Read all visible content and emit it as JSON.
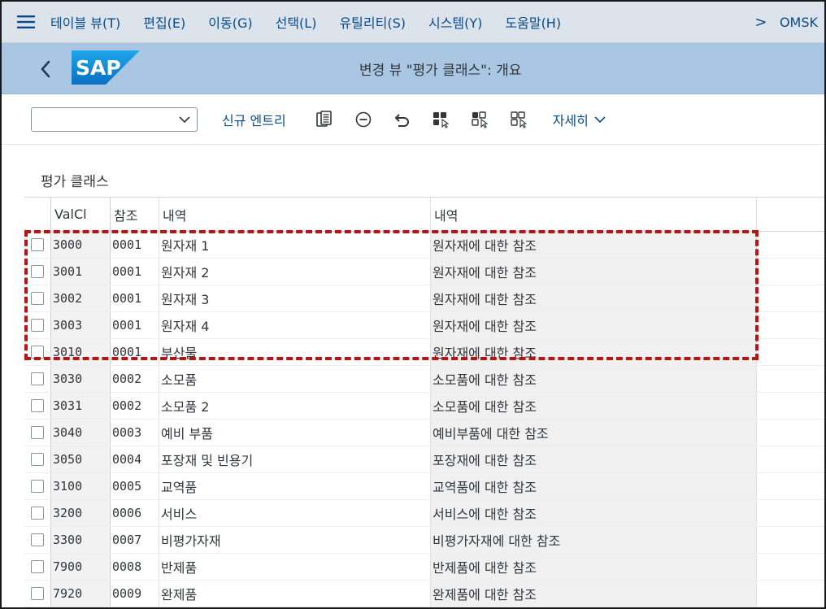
{
  "menu": {
    "items": [
      "테이블 뷰(T)",
      "편집(E)",
      "이동(G)",
      "선택(L)",
      "유틸리티(S)",
      "시스템(Y)",
      "도움말(H)"
    ],
    "more_glyph": ">",
    "system_id": "OMSK"
  },
  "titlebar": {
    "logo_text": "SAP",
    "title": "변경 뷰 \"평가 클래스\": 개요"
  },
  "toolbar": {
    "new_entries_label": "신규 엔트리",
    "details_label": "자세히"
  },
  "section": {
    "title": "평가 클래스"
  },
  "table": {
    "headers": {
      "valcl": "ValCl",
      "ref": "참조",
      "desc1": "내역",
      "desc2": "내역"
    },
    "rows": [
      {
        "valcl": "3000",
        "ref": "0001",
        "desc": "원자재 1",
        "refdesc": "원자재에 대한 참조"
      },
      {
        "valcl": "3001",
        "ref": "0001",
        "desc": "원자재 2",
        "refdesc": "원자재에 대한 참조"
      },
      {
        "valcl": "3002",
        "ref": "0001",
        "desc": "원자재 3",
        "refdesc": "원자재에 대한 참조"
      },
      {
        "valcl": "3003",
        "ref": "0001",
        "desc": "원자재 4",
        "refdesc": "원자재에 대한 참조"
      },
      {
        "valcl": "3010",
        "ref": "0001",
        "desc": "부산물",
        "refdesc": "원자재에 대한 참조"
      },
      {
        "valcl": "3030",
        "ref": "0002",
        "desc": "소모품",
        "refdesc": "소모품에 대한 참조"
      },
      {
        "valcl": "3031",
        "ref": "0002",
        "desc": "소모품 2",
        "refdesc": "소모품에 대한 참조"
      },
      {
        "valcl": "3040",
        "ref": "0003",
        "desc": "예비 부품",
        "refdesc": "예비부품에 대한 참조"
      },
      {
        "valcl": "3050",
        "ref": "0004",
        "desc": "포장재 및 빈용기",
        "refdesc": "포장재에 대한 참조"
      },
      {
        "valcl": "3100",
        "ref": "0005",
        "desc": "교역품",
        "refdesc": "교역품에 대한 참조"
      },
      {
        "valcl": "3200",
        "ref": "0006",
        "desc": "서비스",
        "refdesc": "서비스에 대한 참조"
      },
      {
        "valcl": "3300",
        "ref": "0007",
        "desc": "비평가자재",
        "refdesc": "비평가자재에 대한 참조"
      },
      {
        "valcl": "7900",
        "ref": "0008",
        "desc": "반제품",
        "refdesc": "반제품에 대한 참조"
      },
      {
        "valcl": "7920",
        "ref": "0009",
        "desc": "완제품",
        "refdesc": "완제품에 대한 참조"
      }
    ]
  },
  "colors": {
    "menubar_bg": "#dce3ea",
    "titlebar_bg": "#a9c7e2",
    "link_blue": "#0a4b8c",
    "highlight_red": "#b81414"
  }
}
